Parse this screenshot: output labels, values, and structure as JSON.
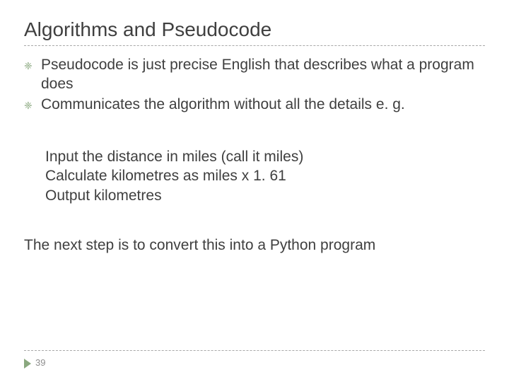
{
  "title": "Algorithms and Pseudocode",
  "bullets": [
    "Pseudocode is just precise English that describes what a program does",
    "Communicates the algorithm without all the details e. g."
  ],
  "pseudocode": [
    "Input the distance in miles (call it miles)",
    "Calculate kilometres as miles x 1. 61",
    "Output kilometres"
  ],
  "closing": "The next step is to convert this into a Python program",
  "page_number": "39",
  "icons": {
    "bullet": "❈"
  }
}
